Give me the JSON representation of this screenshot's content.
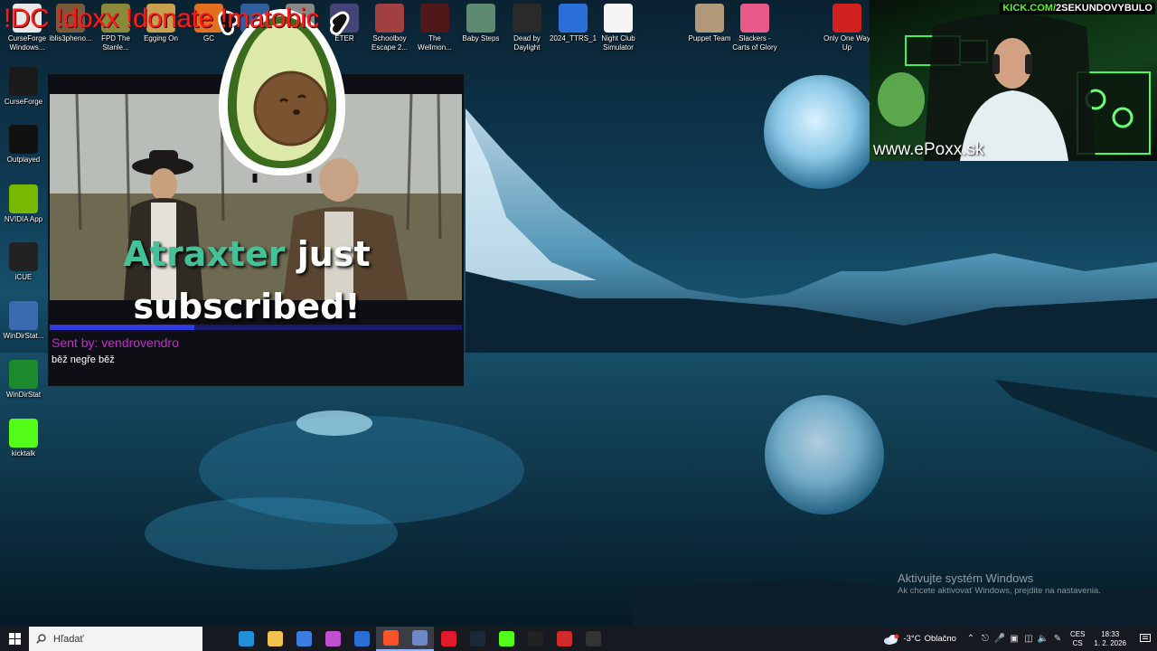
{
  "overlay": {
    "chat_commands": "!DC !doxx !donate !matobic"
  },
  "desktop": {
    "top_icons": [
      {
        "label": "CurseForge Windows...",
        "icon": "curseforge-icon",
        "color": "#e8e8e8"
      },
      {
        "label": "iblis3pheno...",
        "icon": "game-icon",
        "color": "#7a5a3a"
      },
      {
        "label": "FPD The Stanle...",
        "icon": "game-icon",
        "color": "#8a8a3a"
      },
      {
        "label": "Egging On",
        "icon": "game-icon",
        "color": "#c8a050"
      },
      {
        "label": "GC",
        "icon": "game-icon",
        "color": "#e07020"
      },
      {
        "label": "",
        "icon": "game-icon",
        "color": "#2f5f9f"
      },
      {
        "label": "",
        "icon": "game-icon",
        "color": "#888"
      },
      {
        "label": "ETER",
        "icon": "game-icon",
        "color": "#447"
      },
      {
        "label": "Schoolboy Escape 2...",
        "icon": "game-icon",
        "color": "#a04040"
      },
      {
        "label": "The Wellmon...",
        "icon": "game-icon",
        "color": "#501818"
      },
      {
        "label": "Baby Steps",
        "icon": "game-icon",
        "color": "#5d8a70"
      },
      {
        "label": "Dead by Daylight",
        "icon": "game-icon",
        "color": "#2a2a2a"
      },
      {
        "label": "2024_TTRS_1",
        "icon": "app-icon",
        "color": "#2a6ed8"
      },
      {
        "label": "Night Club Simulator",
        "icon": "game-icon",
        "color": "#f4f4f4"
      },
      {
        "label": "Puppet Team",
        "icon": "game-icon",
        "color": "#b09878"
      },
      {
        "label": "Slackers - Carts of Glory",
        "icon": "game-icon",
        "color": "#e85a8a"
      },
      {
        "label": "Only One Way Up",
        "icon": "game-icon",
        "color": "#d02020"
      }
    ],
    "left_icons": [
      {
        "label": "CurseForge",
        "icon": "curseforge-icon",
        "color": "#1b1b1b"
      },
      {
        "label": "Outplayed",
        "icon": "outplayed-icon",
        "color": "#111"
      },
      {
        "label": "NVIDIA App",
        "icon": "nvidia-icon",
        "color": "#76b900"
      },
      {
        "label": "iCUE",
        "icon": "icue-icon",
        "color": "#222"
      },
      {
        "label": "WinDirStat...",
        "icon": "windirstat-icon",
        "color": "#3a6bb0"
      },
      {
        "label": "WinDirStat",
        "icon": "windirstat-icon",
        "color": "#1e8a2e"
      },
      {
        "label": "kicktalk",
        "icon": "kick-icon",
        "color": "#53fc18"
      }
    ]
  },
  "alert": {
    "name": "Atraxter",
    "action": " just subscribed!",
    "sent_by": "Sent by: vendrovendro",
    "message": "běž negře běž",
    "progress": 0.35
  },
  "webcam": {
    "channel_prefix": "KICK.COM/",
    "channel_name": "2SEKUNDOVYBULO",
    "site": "www.ePoxx.sk"
  },
  "watermark": {
    "title": "Aktivujte systém Windows",
    "subtitle": "Ak chcete aktivovať Windows, prejdite na nastavenia."
  },
  "taskbar": {
    "search_placeholder": "Hľadať",
    "apps": [
      {
        "name": "task-view",
        "icon": "task-view-icon",
        "color": "#16191f",
        "active": false
      },
      {
        "name": "edge",
        "icon": "edge-icon",
        "color": "#1f8fd8",
        "active": false
      },
      {
        "name": "file-explorer",
        "icon": "folder-icon",
        "color": "#f2c14e",
        "active": false
      },
      {
        "name": "store",
        "icon": "store-icon",
        "color": "#3b7ee0",
        "active": false
      },
      {
        "name": "m365",
        "icon": "office-icon",
        "color": "#c050d0",
        "active": false
      },
      {
        "name": "mail",
        "icon": "mail-icon",
        "color": "#2a6ed8",
        "active": false
      },
      {
        "name": "brave",
        "icon": "brave-icon",
        "color": "#fb542b",
        "active": true
      },
      {
        "name": "obs",
        "icon": "obs-icon",
        "color": "#6f88c8",
        "active": true
      },
      {
        "name": "opera",
        "icon": "opera-icon",
        "color": "#e01a2a",
        "active": false
      },
      {
        "name": "steam",
        "icon": "steam-icon",
        "color": "#1b2838",
        "active": false
      },
      {
        "name": "kick",
        "icon": "kick-icon",
        "color": "#53fc18",
        "active": false
      },
      {
        "name": "streamdeck",
        "icon": "streamdeck-icon",
        "color": "#222",
        "active": false
      },
      {
        "name": "bandicam",
        "icon": "record-icon",
        "color": "#d02a2a",
        "active": false
      },
      {
        "name": "gauge",
        "icon": "gauge-icon",
        "color": "#333",
        "active": false
      }
    ],
    "weather_temp": "-3°C",
    "weather_text": "Oblačno",
    "lang_top": "CES",
    "lang_bottom": "CS",
    "time": "18:33",
    "date": "1. 2. 2026"
  }
}
